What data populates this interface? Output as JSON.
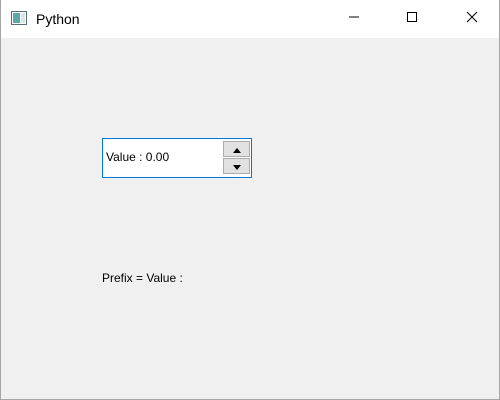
{
  "window": {
    "title": "Python",
    "icon": "python-window-icon",
    "controls": {
      "minimize_icon": "minimize-icon",
      "maximize_icon": "maximize-icon",
      "close_icon": "close-icon"
    }
  },
  "spinbox": {
    "text": "Value : 0.00",
    "up_icon": "arrow-up-icon",
    "down_icon": "arrow-down-icon",
    "border_color": "#0078d7"
  },
  "label": {
    "text": "Prefix = Value :"
  }
}
